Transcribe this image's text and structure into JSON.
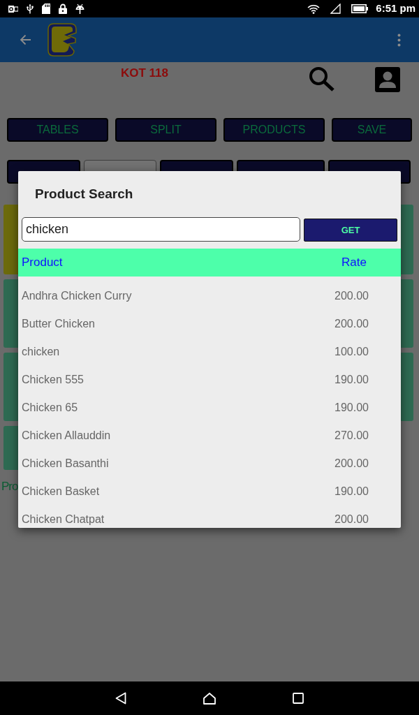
{
  "status_bar": {
    "time": "6:51 pm"
  },
  "kot_label": "KOT 118",
  "action_buttons": [
    "TABLES",
    "SPLIT",
    "PRODUCTS",
    "SAVE"
  ],
  "second_row": [
    {
      "kind": "button"
    },
    {
      "kind": "field"
    },
    {
      "kind": "button"
    },
    {
      "kind": "button"
    },
    {
      "kind": "button"
    }
  ],
  "tiles": [
    {
      "color": "#6c6a0c"
    },
    {
      "color": "#2e6a52"
    },
    {
      "color": "#2e6a52"
    },
    {
      "color": "#2e6a52"
    },
    {
      "color": "#2e6a52"
    },
    {
      "color": "#2e6a52"
    },
    {
      "color": "#2e6a52"
    }
  ],
  "section_label": "Pro",
  "dialog": {
    "title": "Product Search",
    "search": {
      "value": "chicken"
    },
    "get_button": "GET",
    "columns": [
      "Product",
      "Rate"
    ],
    "rows": [
      {
        "product": "Andhra Chicken Curry",
        "rate": "200.00"
      },
      {
        "product": "Butter Chicken",
        "rate": "200.00"
      },
      {
        "product": "chicken",
        "rate": "100.00"
      },
      {
        "product": "Chicken 555",
        "rate": "190.00"
      },
      {
        "product": "Chicken 65",
        "rate": "190.00"
      },
      {
        "product": "Chicken Allauddin",
        "rate": "270.00"
      },
      {
        "product": "Chicken Basanthi",
        "rate": "200.00"
      },
      {
        "product": "Chicken Basket",
        "rate": "190.00"
      },
      {
        "product": "Chicken Chatpat",
        "rate": "200.00"
      }
    ]
  }
}
